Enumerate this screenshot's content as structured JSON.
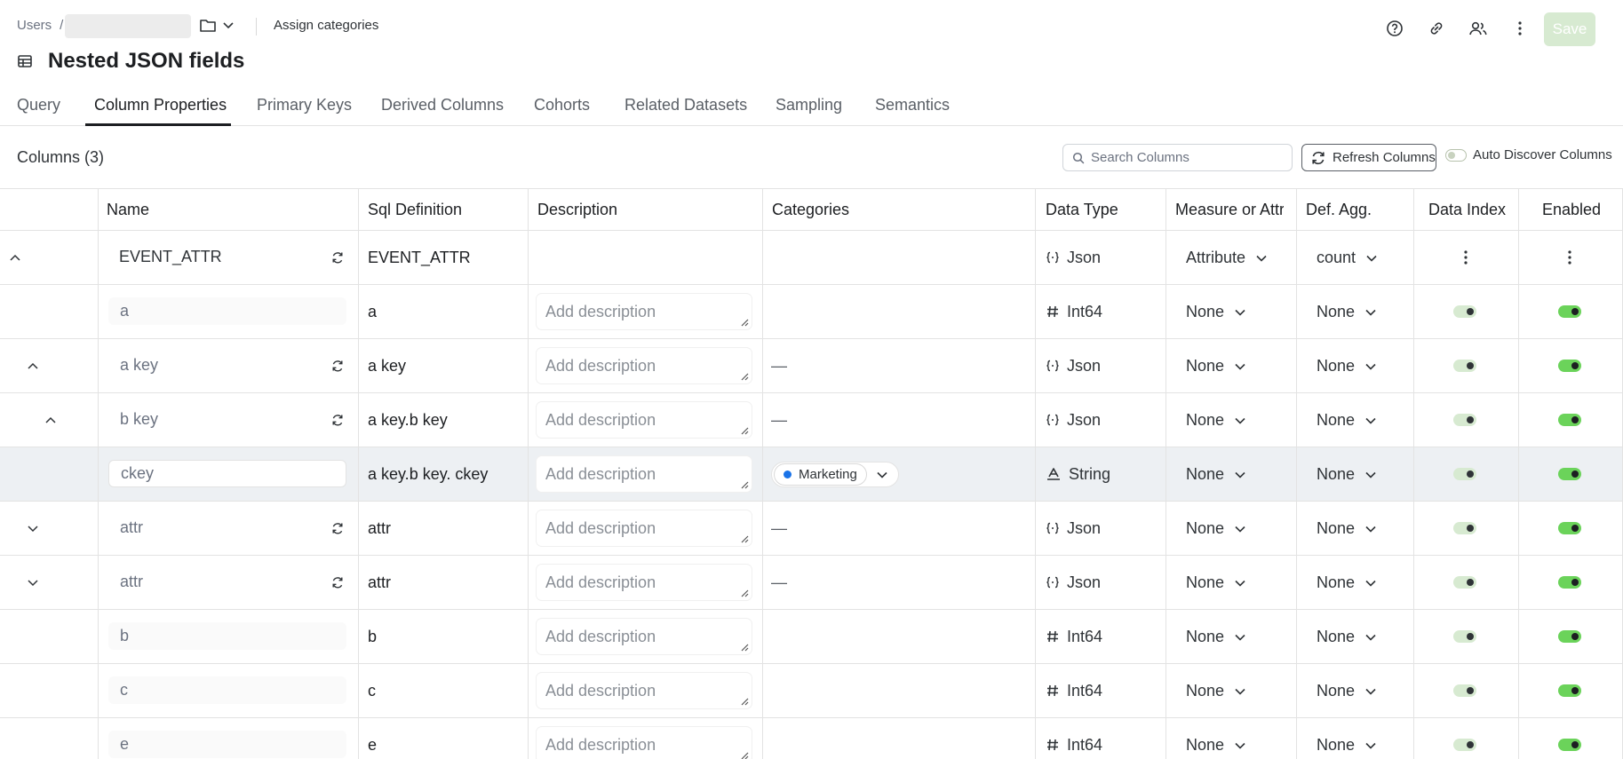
{
  "breadcrumb": {
    "root": "Users",
    "separator": "/",
    "assign_link": "Assign categories"
  },
  "header": {
    "title": "Nested JSON fields",
    "save_label": "Save"
  },
  "tabs": [
    {
      "label": "Query"
    },
    {
      "label": "Column Properties",
      "active": true
    },
    {
      "label": "Primary Keys"
    },
    {
      "label": "Derived Columns"
    },
    {
      "label": "Cohorts"
    },
    {
      "label": "Related Datasets"
    },
    {
      "label": "Sampling"
    },
    {
      "label": "Semantics"
    }
  ],
  "toolbar": {
    "columns_count": "Columns (3)",
    "search_placeholder": "Search Columns",
    "refresh_label": "Refresh Columns",
    "auto_discover_label": "Auto Discover Columns"
  },
  "table": {
    "headers": {
      "name": "Name",
      "sql": "Sql Definition",
      "description": "Description",
      "categories": "Categories",
      "data_type": "Data Type",
      "measure": "Measure or Attribute",
      "def_agg": "Def. Agg.",
      "data_index": "Data Index",
      "enabled": "Enabled"
    },
    "desc_placeholder": "Add description",
    "rows": [
      {
        "name": "EVENT_ATTR",
        "sql": "EVENT_ATTR",
        "desc": "",
        "category": "",
        "type": "Json",
        "measure": "Attribute",
        "agg": "count",
        "expander": "up",
        "level": 0
      },
      {
        "name": "a",
        "sql": "a",
        "desc": "Add description",
        "category": "",
        "type": "Int64",
        "measure": "None",
        "agg": "None",
        "expander": "",
        "level": 1
      },
      {
        "name": "a key",
        "sql": "a key",
        "desc": "Add description",
        "category": "—",
        "type": "Json",
        "measure": "None",
        "agg": "None",
        "expander": "up",
        "level": 1
      },
      {
        "name": "b key",
        "sql": "a key.b key",
        "desc": "Add description",
        "category": "—",
        "type": "Json",
        "measure": "None",
        "agg": "None",
        "expander": "up",
        "level": 2
      },
      {
        "name": "ckey",
        "sql": "a key.b key. ckey",
        "desc": "Add description",
        "category": "Marketing",
        "type": "String",
        "measure": "None",
        "agg": "None",
        "expander": "",
        "level": 3
      },
      {
        "name": "attr",
        "sql": "attr",
        "desc": "Add description",
        "category": "—",
        "type": "Json",
        "measure": "None",
        "agg": "None",
        "expander": "down",
        "level": 1
      },
      {
        "name": "attr",
        "sql": "attr",
        "desc": "Add description",
        "category": "—",
        "type": "Json",
        "measure": "None",
        "agg": "None",
        "expander": "down",
        "level": 1
      },
      {
        "name": "b",
        "sql": "b",
        "desc": "Add description",
        "category": "",
        "type": "Int64",
        "measure": "None",
        "agg": "None",
        "expander": "",
        "level": 1
      },
      {
        "name": "c",
        "sql": "c",
        "desc": "Add description",
        "category": "",
        "type": "Int64",
        "measure": "None",
        "agg": "None",
        "expander": "",
        "level": 1
      },
      {
        "name": "e",
        "sql": "e",
        "desc": "Add description",
        "category": "",
        "type": "Int64",
        "measure": "None",
        "agg": "None",
        "expander": "",
        "level": 1
      }
    ]
  },
  "colors": {
    "accent_green": "#6bd35a",
    "save_bg": "#d7ead1",
    "chip_dot": "#1a73e8"
  }
}
